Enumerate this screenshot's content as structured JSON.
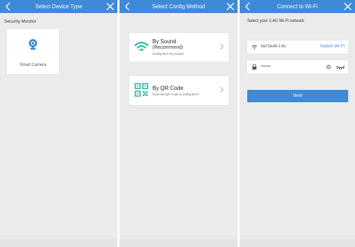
{
  "screens": [
    {
      "title": "Select Device Type",
      "section_label": "Security Monitor",
      "device": {
        "label": "Smart Camera"
      }
    },
    {
      "title": "Select Config Method",
      "methods": [
        {
          "title": "By Sound",
          "subtitle": "(Recommend)",
          "description": "Config Wi-Fi by Sound"
        },
        {
          "title": "By QR Code",
          "description": "Scan the QR Code to config Wi-Fi"
        }
      ]
    },
    {
      "title": "Connect to Wi-Fi",
      "prompt": "Select your 2.4G Wi-Fi network",
      "wifi_name": "NETGEAR 2.4G",
      "switch_label": "Switch Wi-Fi",
      "password_mask": "••••••••",
      "next_label": "Next"
    }
  ],
  "colors": {
    "accent": "#3f8ad6",
    "background": "#ebebeb",
    "card": "#ffffff"
  },
  "icons": {
    "back": "chevron-left-icon",
    "close": "close-icon",
    "camera": "camera-icon",
    "sound": "wifi-signal-icon",
    "qr": "qr-code-icon",
    "wifi": "wifi-icon",
    "lock": "lock-icon",
    "clear": "clear-icon",
    "eye": "eye-closed-icon"
  }
}
